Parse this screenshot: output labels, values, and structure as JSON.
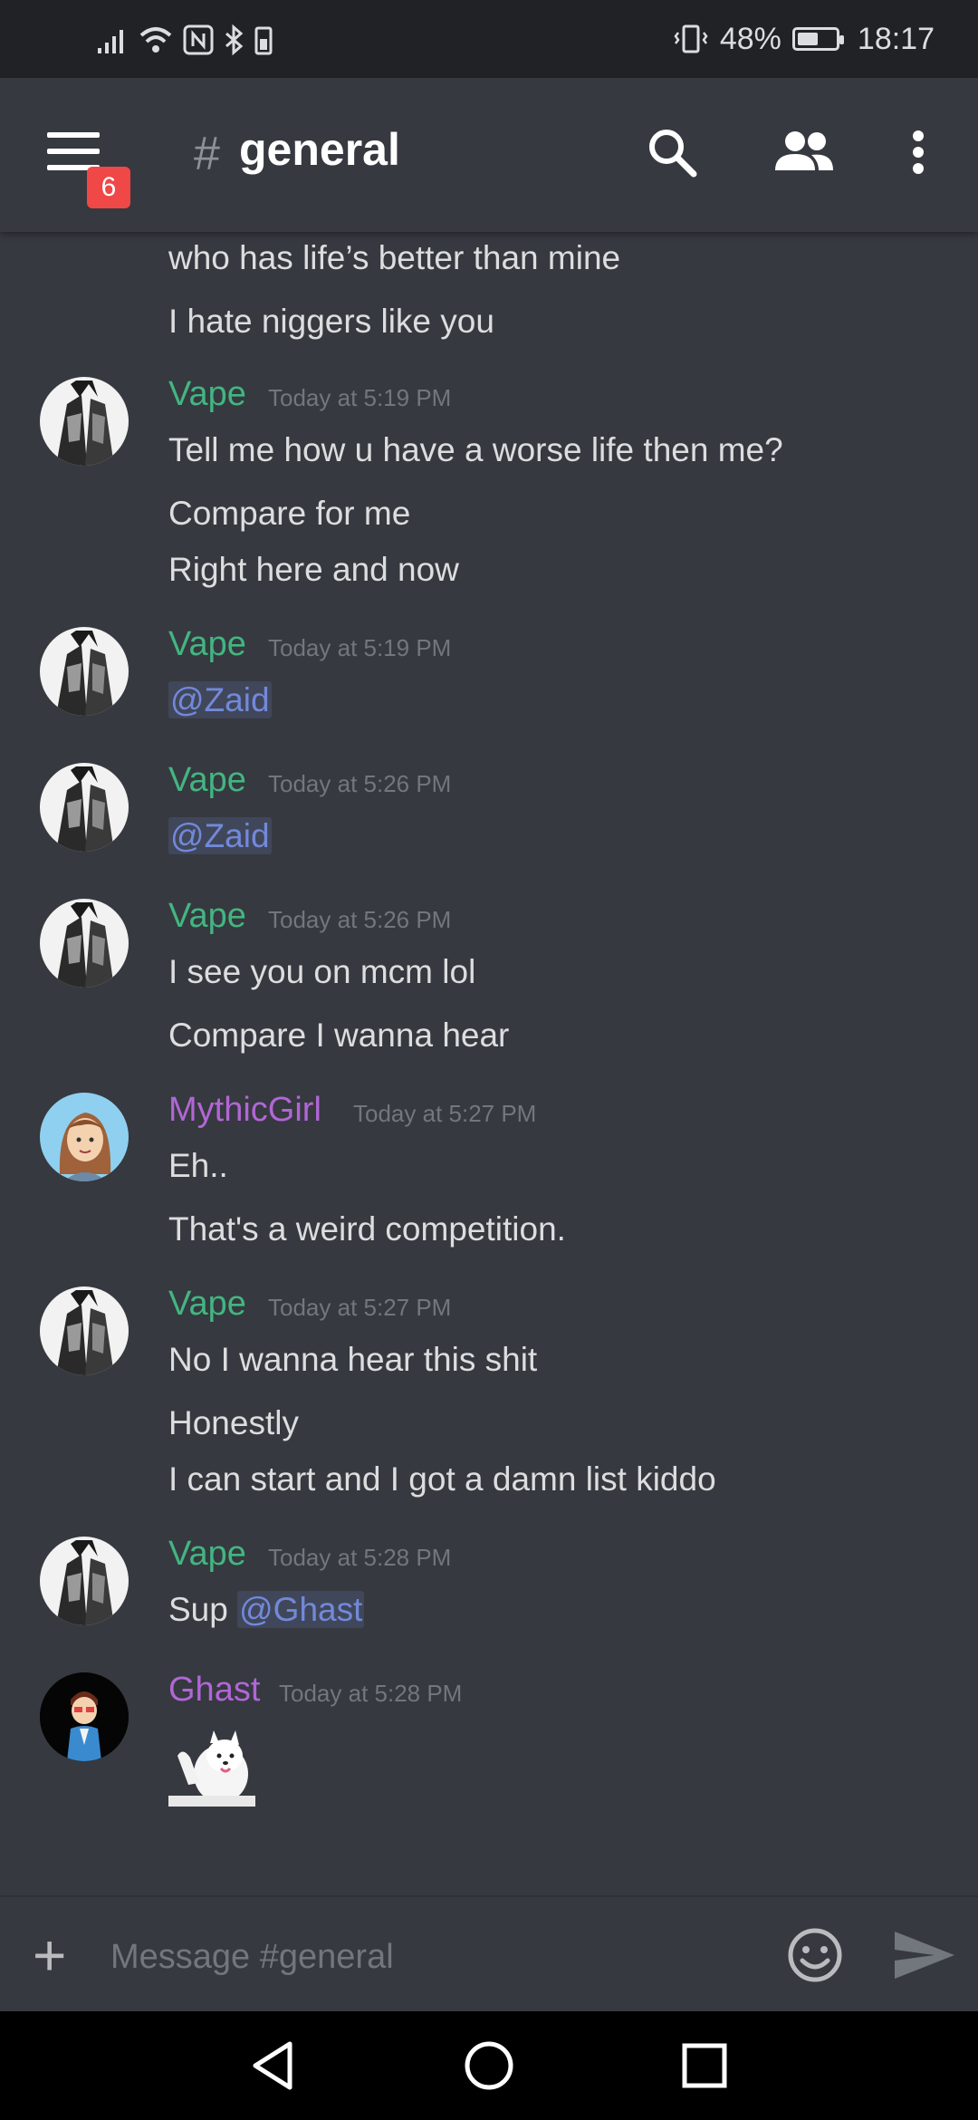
{
  "status_bar": {
    "battery_percent": "48%",
    "time": "18:17"
  },
  "header": {
    "hash": "#",
    "channel": "general",
    "badge_count": "6"
  },
  "messages": {
    "prev_line1": "who has life’s better than mine",
    "prev_line2": "I hate niggers like you",
    "m1": {
      "author": "Vape",
      "time": "Today at 5:19 PM",
      "l1": "Tell me how u have a worse life then me?",
      "l2": "Compare for me",
      "l3": "Right here and now"
    },
    "m2": {
      "author": "Vape",
      "time": "Today at 5:19 PM",
      "mention": "@Zaid"
    },
    "m3": {
      "author": "Vape",
      "time": "Today at 5:26 PM",
      "mention": "@Zaid"
    },
    "m4": {
      "author": "Vape",
      "time": "Today at 5:26 PM",
      "l1": "I see you on mcm lol",
      "l2": "Compare I wanna hear"
    },
    "m5": {
      "author": "MythicGirl",
      "time": "Today at 5:27 PM",
      "l1": "Eh..",
      "l2": "That's a weird competition."
    },
    "m6": {
      "author": "Vape",
      "time": "Today at 5:27 PM",
      "l1": "No I wanna hear this shit",
      "l2": "Honestly",
      "l3": "I can start and I got a damn list kiddo"
    },
    "m7": {
      "author": "Vape",
      "time": "Today at 5:28 PM",
      "text": "Sup",
      "mention": "@Ghast"
    },
    "m8": {
      "author": "Ghast",
      "time": "Today at 5:28 PM"
    }
  },
  "composer": {
    "placeholder": "Message #general",
    "plus": "+"
  },
  "colors": {
    "vape": "#43b581",
    "purple": "#b166d6",
    "mention": "#7289da",
    "background": "#36393f"
  },
  "icons": {
    "menu": "hamburger-menu-icon",
    "search": "search-icon",
    "members": "members-icon",
    "more": "more-vertical-icon",
    "emoji": "emoji-icon",
    "send": "send-icon",
    "back": "nav-back-icon",
    "home": "nav-home-icon",
    "recents": "nav-recents-icon"
  }
}
